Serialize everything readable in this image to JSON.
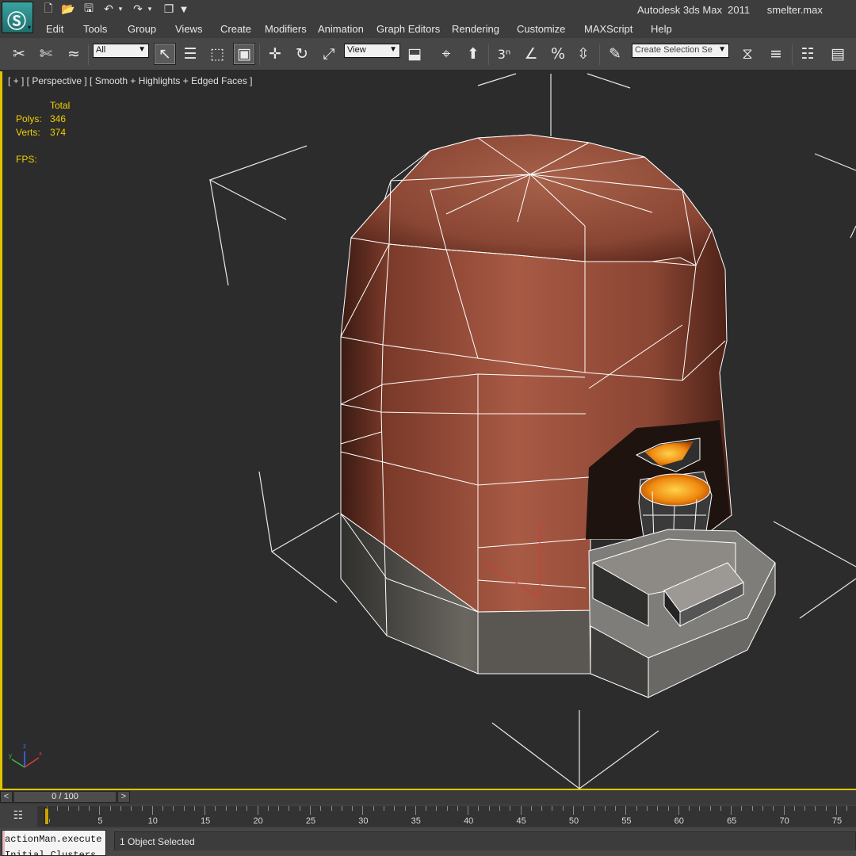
{
  "window": {
    "app_title": "Autodesk 3ds Max  2011",
    "file_name": "smelter.max"
  },
  "quick_access": {
    "icons": [
      "new-file-icon",
      "open-file-icon",
      "save-icon",
      "undo-icon",
      "redo-icon",
      "project-folder-icon"
    ]
  },
  "menu": {
    "items": [
      "Edit",
      "Tools",
      "Group",
      "Views",
      "Create",
      "Modifiers",
      "Animation",
      "Graph Editors",
      "Rendering",
      "Customize",
      "MAXScript",
      "Help"
    ]
  },
  "toolbar": {
    "selection_filter": "All",
    "reference_coord": "View",
    "named_selection_placeholder": "Create Selection Se"
  },
  "viewport": {
    "label": "[ + ] [ Perspective ] [ Smooth + Highlights + Edged Faces ]",
    "stats": {
      "header": "Total",
      "polys_label": "Polys:",
      "polys_value": "346",
      "verts_label": "Verts:",
      "verts_value": "374",
      "fps_label": "FPS:"
    },
    "axis_labels": {
      "x": "x",
      "y": "y",
      "z": "z"
    }
  },
  "time_slider": {
    "prev": "<",
    "frame_display": "0 / 100",
    "next": ">"
  },
  "track_bar": {
    "ticks": [
      "0",
      "5",
      "10",
      "15",
      "20",
      "25",
      "30",
      "35",
      "40",
      "45",
      "50",
      "55",
      "60",
      "65",
      "70",
      "75"
    ],
    "current_frame": 0
  },
  "status": {
    "script_line1": "actionMan.execute",
    "script_line2": "Initial Clusters",
    "selection_text": "1 Object Selected"
  },
  "colors": {
    "viewport_border": "#e0c400",
    "stats_text": "#f0d000",
    "viewport_bg": "#2c2c2c"
  }
}
